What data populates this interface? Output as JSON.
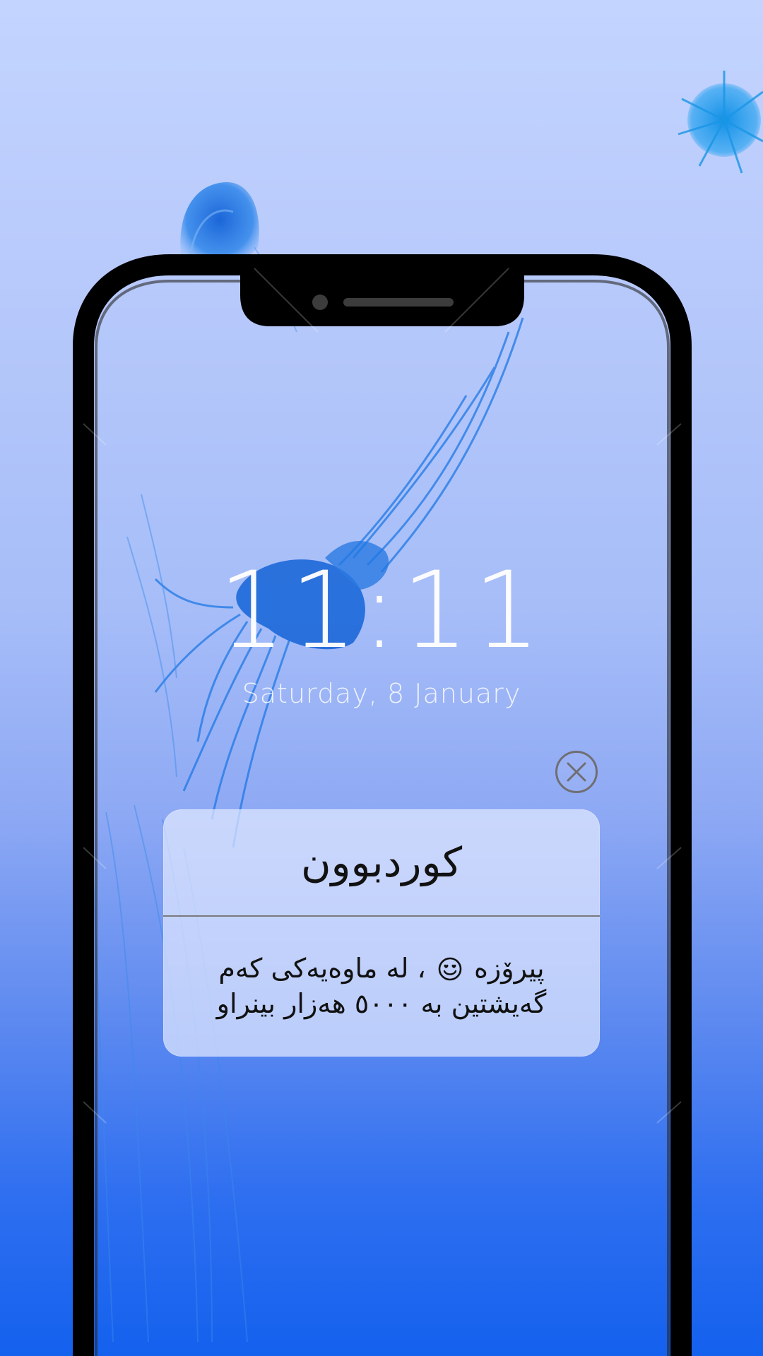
{
  "lockscreen": {
    "time": "11:11",
    "date": "Saturday, 8 January"
  },
  "notification": {
    "title": "کوردبوون",
    "body_line1_before": "پیرۆزە",
    "body_line1_after": "، لە ماوەیەکی کەم",
    "body_line2": "گەیشتین بە ٥٠٠٠ هەزار بینراو",
    "emoji_icon": "smiling-face-with-heart-eyes-icon"
  },
  "icons": {
    "close": "close-x-circle-icon",
    "camera": "front-camera-icon",
    "speaker": "earpiece-speaker-icon"
  },
  "colors": {
    "wallpaper_top": "#c3d4ff",
    "wallpaper_bottom": "#1461ee",
    "jellyfish": "#1a6fe0",
    "phone_frame": "#000000",
    "notification_bg": "#e2e9ff",
    "divider": "#7a7a7e"
  }
}
